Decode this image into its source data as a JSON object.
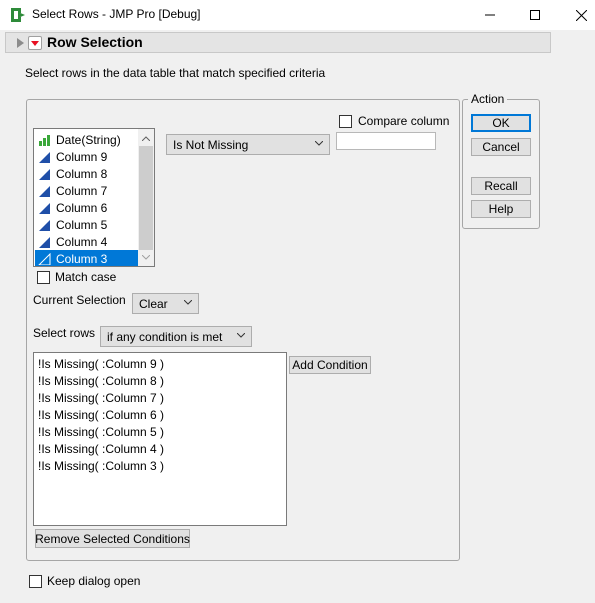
{
  "window": {
    "title": "Select Rows - JMP Pro [Debug]",
    "controls": [
      "minimize-icon",
      "maximize-icon",
      "close-icon"
    ]
  },
  "section": {
    "title": "Row Selection",
    "instructions": "Select rows in the data table that match specified criteria"
  },
  "columns": {
    "items": [
      {
        "label": "Date(String)",
        "icon": "bar-chart-icon"
      },
      {
        "label": "Column 9",
        "icon": "continuous-column-icon"
      },
      {
        "label": "Column 8",
        "icon": "continuous-column-icon"
      },
      {
        "label": "Column 7",
        "icon": "continuous-column-icon"
      },
      {
        "label": "Column 6",
        "icon": "continuous-column-icon"
      },
      {
        "label": "Column 5",
        "icon": "continuous-column-icon"
      },
      {
        "label": "Column 4",
        "icon": "continuous-column-icon"
      },
      {
        "label": "Column 3",
        "icon": "continuous-column-icon"
      }
    ],
    "selected": "Column 3"
  },
  "condition": {
    "operator": "Is Not Missing",
    "compare_column_label": "Compare column",
    "compare_column_checked": false,
    "value": ""
  },
  "match_case": {
    "label": "Match case",
    "checked": false
  },
  "current_selection": {
    "label": "Current Selection",
    "value": "Clear"
  },
  "select_rows": {
    "label": "Select rows",
    "value": "if any condition is met"
  },
  "add_condition_label": "Add Condition",
  "conditions": [
    "!Is Missing( :Column 9 )",
    "!Is Missing( :Column 8 )",
    "!Is Missing( :Column 7 )",
    "!Is Missing( :Column 6 )",
    "!Is Missing( :Column 5 )",
    "!Is Missing( :Column 4 )",
    "!Is Missing( :Column 3 )"
  ],
  "remove_label": "Remove Selected Conditions",
  "action": {
    "title": "Action",
    "ok": "OK",
    "cancel": "Cancel",
    "recall": "Recall",
    "help": "Help"
  },
  "keep_open": {
    "label": "Keep dialog open",
    "checked": false
  },
  "colors": {
    "selection": "#0078d7",
    "disclosure_red": "#e81123",
    "column_icon_blue": "#1f4fa8",
    "bar_icon_green": "#3aa83a"
  }
}
